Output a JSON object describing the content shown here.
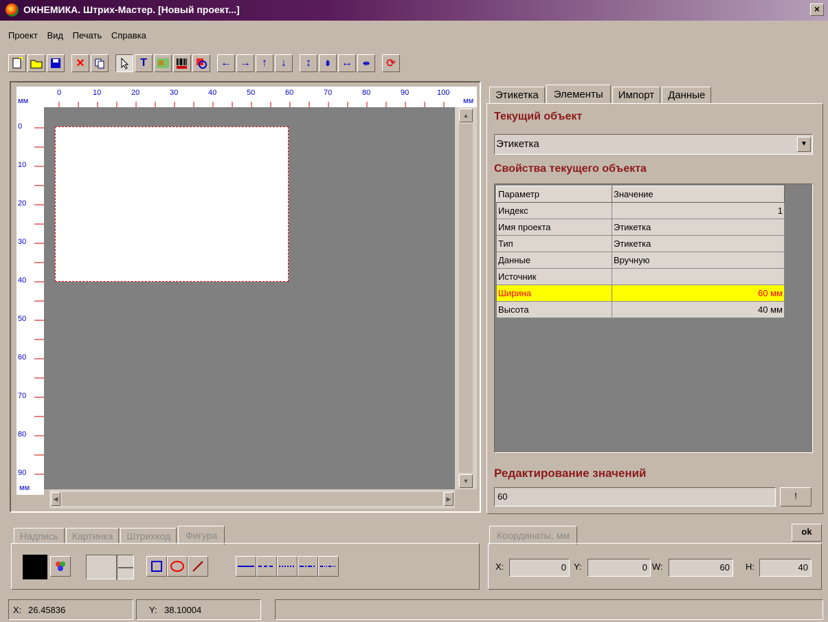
{
  "window": {
    "title": "ОКНЕМИКА. Штрих-Мастер. [Новый проект...]",
    "close": "×"
  },
  "menu": [
    "Проект",
    "Вид",
    "Печать",
    "Справка"
  ],
  "toolbar": {
    "icons": [
      "new-doc-icon",
      "open-folder-icon",
      "save-icon",
      "delete-icon",
      "copy-icon",
      "pointer-icon",
      "text-icon",
      "image-icon",
      "barcode-icon",
      "shape-icon",
      "arrow-left-icon",
      "arrow-right-icon",
      "arrow-up-icon",
      "arrow-down-icon",
      "expand-vertical-icon",
      "shrink-vertical-icon",
      "expand-horizontal-icon",
      "shrink-horizontal-icon",
      "refresh-icon"
    ]
  },
  "ruler": {
    "unit": "мм",
    "h_ticks": [
      "0",
      "10",
      "20",
      "30",
      "40",
      "50",
      "60",
      "70",
      "80",
      "90",
      "100"
    ],
    "v_ticks": [
      "0",
      "10",
      "20",
      "30",
      "40",
      "50",
      "60",
      "70",
      "80",
      "90"
    ]
  },
  "right": {
    "tabs": [
      "Этикетка",
      "Элементы",
      "Импорт",
      "Данные"
    ],
    "current_title": "Текущий объект",
    "current_value": "Этикетка",
    "props_title": "Свойства текущего объекта",
    "headers": [
      "Параметр",
      "Значение"
    ],
    "rows": [
      [
        "Индекс",
        "1"
      ],
      [
        "Имя проекта",
        "Этикетка"
      ],
      [
        "Тип",
        "Этикетка"
      ],
      [
        "Данные",
        "Вручную"
      ],
      [
        "Источник",
        ""
      ],
      [
        "Ширина",
        "60 мм"
      ],
      [
        "Высота",
        "40 мм"
      ]
    ],
    "edit_title": "Редактирование значений",
    "edit_value": "60",
    "edit_btn": "!"
  },
  "bottom_left": {
    "tabs": [
      "Надпись",
      "Картинка",
      "Штрихкод",
      "Фигура"
    ]
  },
  "bottom_right": {
    "tab": "Координаты, мм",
    "ok": "ok",
    "x_label": "X:",
    "x": "0",
    "y_label": "Y:",
    "y": "0",
    "w_label": "W:",
    "w": "60",
    "h_label": "H:",
    "h": "40"
  },
  "status": {
    "x_label": "X:",
    "x": "26.45836",
    "y_label": "Y:",
    "y": "38.10004"
  },
  "colors": {
    "title_start": "#3a0a3d",
    "accent_red": "#8b1a1a",
    "highlight": "#ffff00",
    "ruler_blue": "#0000cc",
    "ruler_red": "#cc0000"
  }
}
